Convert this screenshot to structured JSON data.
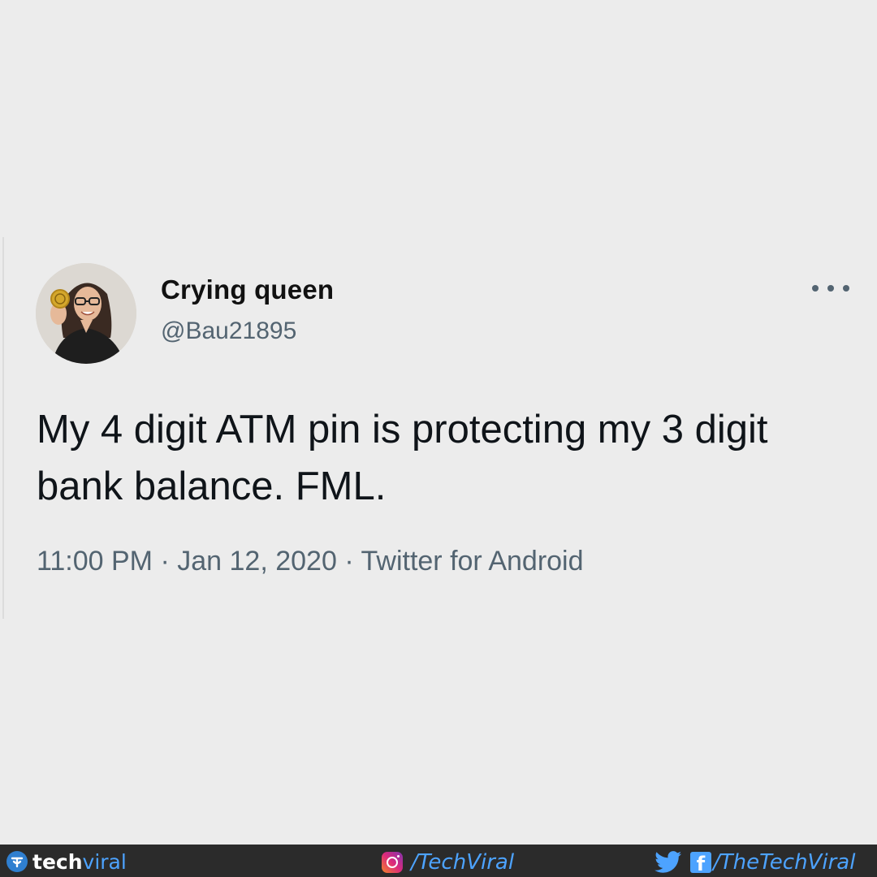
{
  "tweet": {
    "display_name": "Crying queen",
    "handle": "@Bau21895",
    "text": "My 4 digit ATM pin is protecting my 3 digit bank balance. FML.",
    "time": "11:00 PM",
    "separator": "·",
    "date": "Jan 12, 2020",
    "source": "Twitter for Android",
    "more_icon": "more-horizontal-icon"
  },
  "footer": {
    "brand_tech": "tech",
    "brand_viral": "viral",
    "instagram_handle": "/TechViral",
    "facebook_glyph": "f",
    "twitter_facebook_handle": "/TheTechViral",
    "background": "#2b2b2b",
    "accent": "#4da3ff"
  },
  "colors": {
    "background": "#ececec",
    "text_primary": "#0f1419",
    "text_secondary": "#536471"
  }
}
